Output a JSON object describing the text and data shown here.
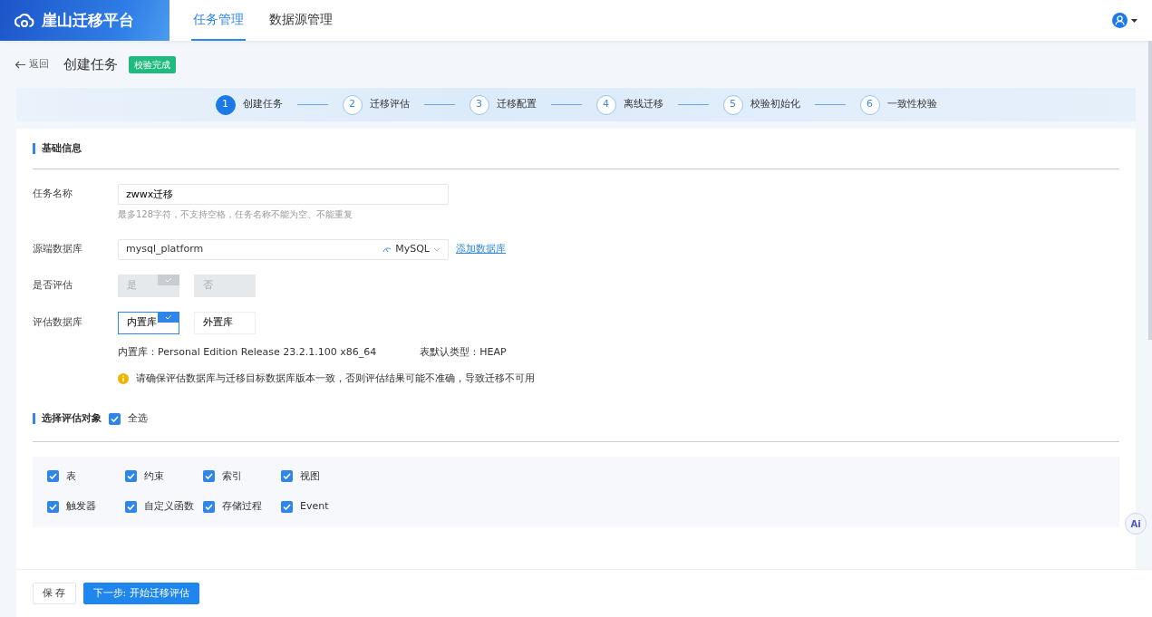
{
  "navbar": {
    "brand": "崖山迁移平台",
    "tabs": [
      {
        "label": "任务管理",
        "selected": true
      },
      {
        "label": "数据源管理",
        "selected": false
      }
    ]
  },
  "header": {
    "back": "返回",
    "title": "创建任务",
    "badge": "校验完成"
  },
  "steps": [
    {
      "number": "1",
      "label": "创建任务",
      "selected": true
    },
    {
      "number": "2",
      "label": "迁移评估",
      "selected": false
    },
    {
      "number": "3",
      "label": "迁移配置",
      "selected": false
    },
    {
      "number": "4",
      "label": "离线迁移",
      "selected": false
    },
    {
      "number": "5",
      "label": "校验初始化",
      "selected": false
    },
    {
      "number": "6",
      "label": "一致性校验",
      "selected": false
    }
  ],
  "basic_info": {
    "title": "基础信息",
    "task_name": {
      "label": "任务名称",
      "value": "zwwx迁移",
      "hint": "最多128字符，不支持空格，任务名称不能为空、不能重复"
    },
    "source_db": {
      "label": "源端数据库",
      "value": "mysql_platform",
      "db_type": "MySQL",
      "link": "添加数据库"
    },
    "evaluate": {
      "label": "是否评估",
      "disabled": true,
      "options": [
        {
          "label": "是",
          "selected": true
        },
        {
          "label": "否",
          "selected": false
        }
      ]
    },
    "eval_db": {
      "label": "评估数据库",
      "disabled": false,
      "options": [
        {
          "label": "内置库",
          "selected": true
        },
        {
          "label": "外置库",
          "selected": false
        }
      ],
      "info": [
        "内置库：Personal Edition Release 23.2.1.100 x86_64",
        "表默认类型：HEAP"
      ],
      "warning": "请确保评估数据库与迁移目标数据库版本一致，否则评估结果可能不准确，导致迁移不可用"
    }
  },
  "objects": {
    "title": "选择评估对象",
    "select_all": {
      "label": "全选",
      "checked": true
    },
    "items": [
      {
        "label": "表",
        "checked": true
      },
      {
        "label": "约束",
        "checked": true
      },
      {
        "label": "索引",
        "checked": true
      },
      {
        "label": "视图",
        "checked": true
      },
      {
        "label": "触发器",
        "checked": true
      },
      {
        "label": "自定义函数",
        "checked": true
      },
      {
        "label": "存储过程",
        "checked": true
      },
      {
        "label": "Event",
        "checked": true
      }
    ]
  },
  "ai_button": "Ai",
  "footer": {
    "buttons": [
      {
        "label": "保 存",
        "kind": "secondary"
      },
      {
        "label": "下一步: 开始迁移评估",
        "kind": "primary"
      }
    ]
  }
}
